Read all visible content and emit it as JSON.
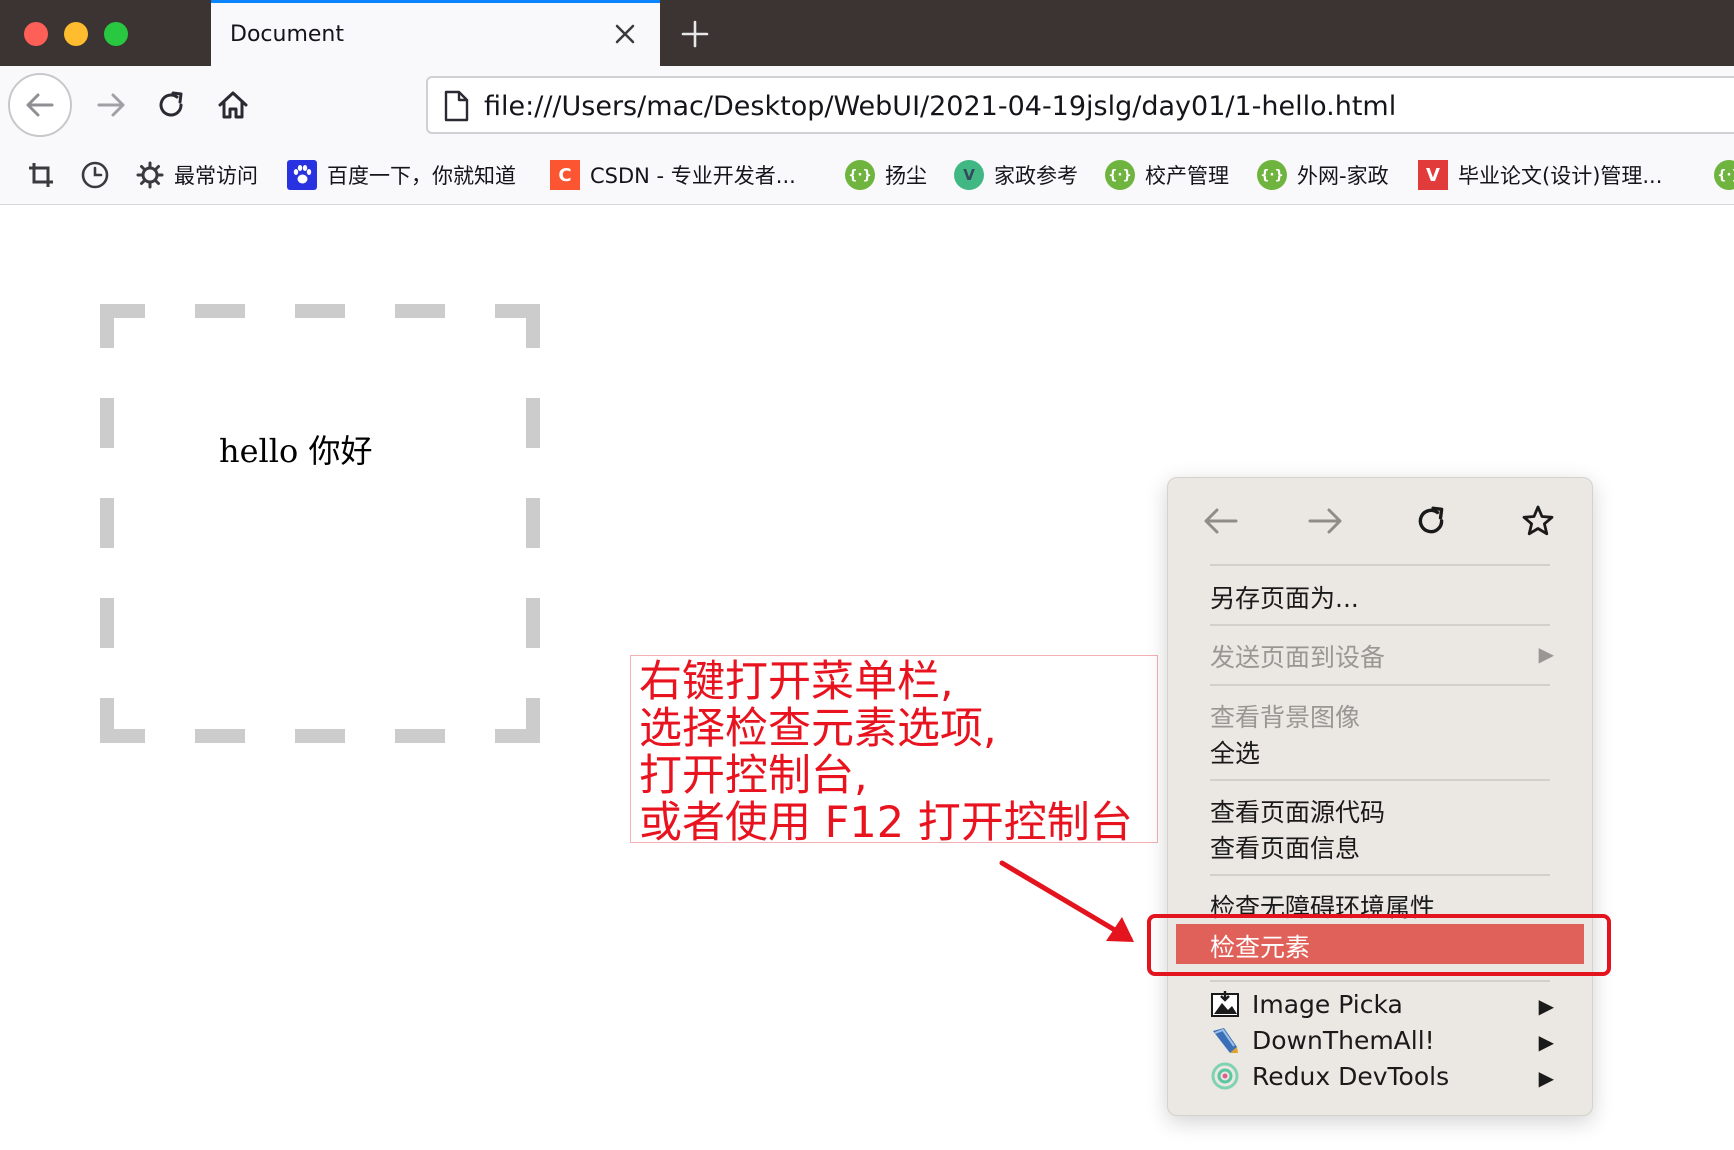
{
  "tab": {
    "title": "Document"
  },
  "address_bar": {
    "url": "file:///Users/mac/Desktop/WebUI/2021-04-19jslg/day01/1-hello.html"
  },
  "bookmarks": [
    {
      "label": "最常访问"
    },
    {
      "label": "百度一下，你就知道"
    },
    {
      "label": "CSDN - 专业开发者..."
    },
    {
      "label": "扬尘"
    },
    {
      "label": "家政参考"
    },
    {
      "label": "校产管理"
    },
    {
      "label": "外网-家政"
    },
    {
      "label": "毕业论文(设计)管理..."
    }
  ],
  "page": {
    "hello_text": "hello 你好"
  },
  "annotation": {
    "lines": [
      "右键打开菜单栏,",
      "选择检查元素选项,",
      "打开控制台,",
      "或者使用 F12 打开控制台"
    ]
  },
  "context_menu": {
    "save_as": "另存页面为...",
    "send_to_device": "发送页面到设备",
    "view_background": "查看背景图像",
    "select_all": "全选",
    "view_source": "查看页面源代码",
    "view_info": "查看页面信息",
    "inspect_accessibility": "检查无障碍环境属性",
    "inspect_element": "检查元素",
    "extensions": [
      {
        "label": "Image Picka"
      },
      {
        "label": "DownThemAll!"
      },
      {
        "label": "Redux DevTools"
      }
    ]
  },
  "colors": {
    "highlight": "#e06159",
    "annotation_red": "#e8131f",
    "dashed_border": "#cccccc"
  }
}
